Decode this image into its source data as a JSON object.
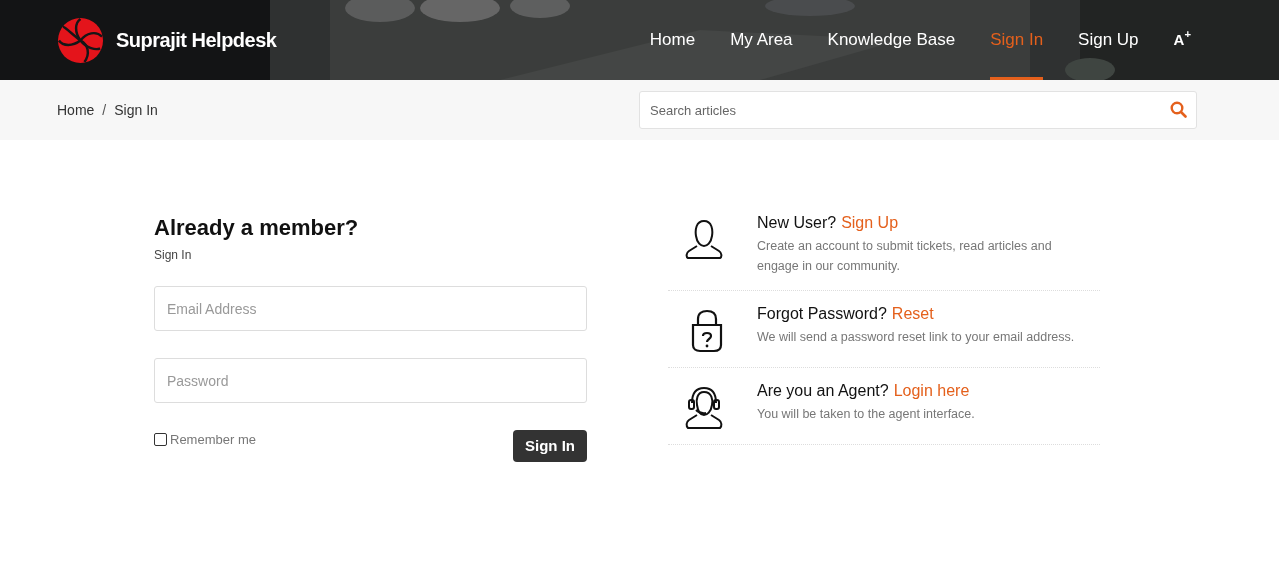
{
  "header": {
    "brand": "Suprajit Helpdesk",
    "nav": [
      {
        "label": "Home",
        "selected": false
      },
      {
        "label": "My Area",
        "selected": false
      },
      {
        "label": "Knowledge Base",
        "selected": false
      },
      {
        "label": "Sign In",
        "selected": true
      },
      {
        "label": "Sign Up",
        "selected": false
      }
    ],
    "font_size_button": "A$^{+}$"
  },
  "breadcrumb": {
    "items": [
      "Home",
      "Sign In"
    ],
    "separator": "/"
  },
  "search": {
    "placeholder": "Search articles"
  },
  "sign_in": {
    "title": "Already a member?",
    "subtitle": "Sign In",
    "fields": [
      {
        "placeholder": "Email Address"
      },
      {
        "placeholder": "Password"
      }
    ],
    "remember_me": {
      "label": "Remember me",
      "checked": false
    },
    "button": "Sign In"
  },
  "options": [
    {
      "kind": "user",
      "question": "New User?",
      "link": "Sign Up",
      "description": "Create an account to submit tickets, read articles and engage in our community."
    },
    {
      "kind": "lock",
      "question": "Forgot Password?",
      "link": "Reset",
      "description": "We will send a password reset link to your email address."
    },
    {
      "kind": "agent",
      "question": "Are you an Agent?",
      "link": "Login here",
      "description": "You will be taken to the agent interface."
    }
  ]
}
